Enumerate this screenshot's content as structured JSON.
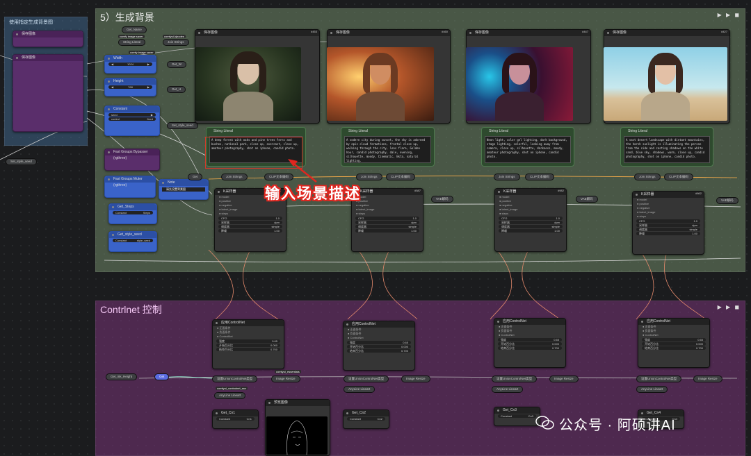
{
  "groups": {
    "background": "5）生成背景",
    "controlnet": "Contrlnet 控制",
    "left": "使用指定生成背景图"
  },
  "callout": "输入场景描述",
  "watermark": "公众号 · 阿硕讲AI",
  "labels": {
    "get_name": "Get_Name",
    "string_literal": "String Literal",
    "join_strings": "Join Strings",
    "save_image": "保存图像",
    "comfy_image_saver": "comfy image saver",
    "comfyui_kjnodes": "comfyui-kjnodes",
    "width": "Width",
    "height": "Height",
    "get_w": "Get_W",
    "get_h": "Get_H",
    "width_val": "1024",
    "height_val": "768",
    "set_seed": "Set_style_seed",
    "fast_groups_bypasser": "Fast Groups Bypasser (rgthree)",
    "fast_groups_muter": "Fast Groups Muter (rgthree)",
    "note": "Note",
    "note_text": "请先设置背景图",
    "get": "Get",
    "clip_encode": "CLIP文本编码",
    "ksampler": "K采样器",
    "vae_decode": "VAE解码",
    "latent": "LATENT",
    "get_steps": "Get_Steps",
    "get_style_seed": "Get_style_seed",
    "constant": "Constant",
    "apply_controlnet": "应用ControlNet",
    "get_ink_height": "Get_ink_Height",
    "image_resize": "Image Resize",
    "set_union": "设置UnionControlNet类型",
    "depth_lineart": "AnyLine Lineart",
    "preview": "预览图像",
    "get_cn1": "Get_Cn1",
    "get_cn2": "Get_Cn2",
    "get_cn3": "Get_Cn3",
    "get_cn4": "Get_Cn4",
    "comfyui_essentials": "comfyui_essentials",
    "comfyui_controlnet_aux": "comfyui_controlnet_aux"
  },
  "prompts": [
    "A deep forest with oaks and pine trees ferns and bushes, national park, close up, overcast, close up, amateur photography, shot on iphone, candid photo.",
    "A sodern city during sunset, the sky is adorned by epic cloud formations, frontal close up, walking through the city, lens flare, Golden hour, candid photography, dale, evening, silhouette, moody, Cinematic, Ekta, natural lighting.",
    "Neon light, color gel lighting, dark background, stage lighting, colorful, looking away from camera, close up, silhouette, darkness, moody, amateur photography, shot on iphone, candid photo.",
    "A vast desert landscape with distant mountains, the harsh sunlight is illuminating the person from the side and casting shadows on the white sand, blue sky, shadows, warm, close up, candid photography, shot on iphone, candid photo."
  ],
  "node_ids": {
    "img1": "#453",
    "img2": "#460",
    "img3": "#447",
    "img4": "#427",
    "ks1": "#587",
    "ks2": "#982",
    "ks3": "#862"
  },
  "sampler_widgets": {
    "seed": "seed",
    "steps": "步数",
    "cfg": "CFG",
    "sampler": "采样器",
    "scheduler": "调度器",
    "denoise": "降噪",
    "cfg_val": "1.0",
    "sampler_val": "dpm",
    "scheduler_val": "simple",
    "denoise_val": "1.00"
  },
  "cn_widgets": {
    "strength": "强度",
    "start": "开始百分比",
    "end": "结束百分比",
    "strength_val": "0.65",
    "start_val": "0.000",
    "end_val": "0.700"
  },
  "colors": {
    "accent": "#3a63c9",
    "callout_outline": "#e0261f"
  }
}
